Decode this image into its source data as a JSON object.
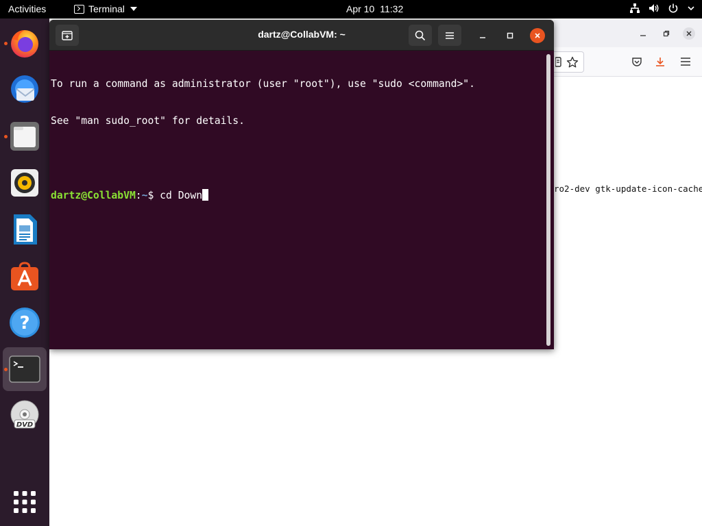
{
  "topbar": {
    "activities": "Activities",
    "app_name": "Terminal",
    "date": "Apr 10",
    "time": "11:32",
    "icons": [
      "network-icon",
      "volume-icon",
      "power-icon",
      "chevron-down-icon"
    ]
  },
  "dock": {
    "items": [
      {
        "name": "firefox",
        "icon": "firefox-icon",
        "running": true
      },
      {
        "name": "thunderbird",
        "icon": "thunderbird-icon",
        "running": false
      },
      {
        "name": "files",
        "icon": "files-icon",
        "running": true
      },
      {
        "name": "rhythmbox",
        "icon": "rhythmbox-icon",
        "running": false
      },
      {
        "name": "libreoffice-writer",
        "icon": "writer-icon",
        "running": false
      },
      {
        "name": "software",
        "icon": "software-icon",
        "running": false
      },
      {
        "name": "help",
        "icon": "help-icon",
        "running": false
      },
      {
        "name": "terminal",
        "icon": "terminal-icon",
        "running": true,
        "active": true
      },
      {
        "name": "dvd",
        "icon": "dvd-icon",
        "running": false,
        "label": "DVD"
      },
      {
        "name": "show-apps",
        "icon": "app-grid-icon",
        "running": false
      }
    ]
  },
  "terminal": {
    "title": "dartz@CollabVM: ~",
    "lines": [
      "To run a command as administrator (user \"root\"), use \"sudo <command>\".",
      "See \"man sudo_root\" for details."
    ],
    "prompt_user": "dartz@CollabVM",
    "prompt_sep": ":",
    "prompt_path": "~",
    "prompt_symbol": "$ ",
    "command": "cd Down"
  },
  "firefox": {
    "content_text": "ro2-dev gtk-update-icon-cache"
  },
  "colors": {
    "terminal_bg": "#300a24",
    "dock_bg": "#2b1b2b",
    "accent": "#e95420",
    "prompt_user": "#8ae234",
    "prompt_path": "#729fcf"
  }
}
